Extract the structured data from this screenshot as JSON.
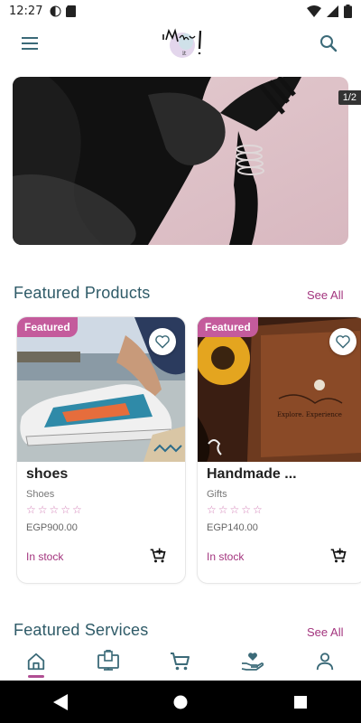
{
  "status_bar": {
    "time": "12:27"
  },
  "app_bar": {
    "logo_text": "I Make it!"
  },
  "banner": {
    "counter": "1/2"
  },
  "featured_products": {
    "title": "Featured Products",
    "see_all": "See All",
    "items": [
      {
        "badge": "Featured",
        "name": "shoes",
        "category": "Shoes",
        "stars": "☆☆☆☆☆",
        "price": "EGP900.00",
        "stock": "In stock"
      },
      {
        "badge": "Featured",
        "name": "Handmade ...",
        "category": "Gifts",
        "stars": "☆☆☆☆☆",
        "price": "EGP140.00",
        "stock": "In stock"
      }
    ]
  },
  "featured_services": {
    "title": "Featured Services",
    "see_all": "See All"
  },
  "bottom_nav": {
    "items": [
      "home-icon",
      "shop-icon",
      "cart-icon",
      "donate-icon",
      "profile-icon"
    ],
    "active": "home-icon"
  },
  "colors": {
    "accent": "#a3347e",
    "badge": "#c45b9c",
    "title": "#2f5b68",
    "icon": "#3b6a78"
  }
}
